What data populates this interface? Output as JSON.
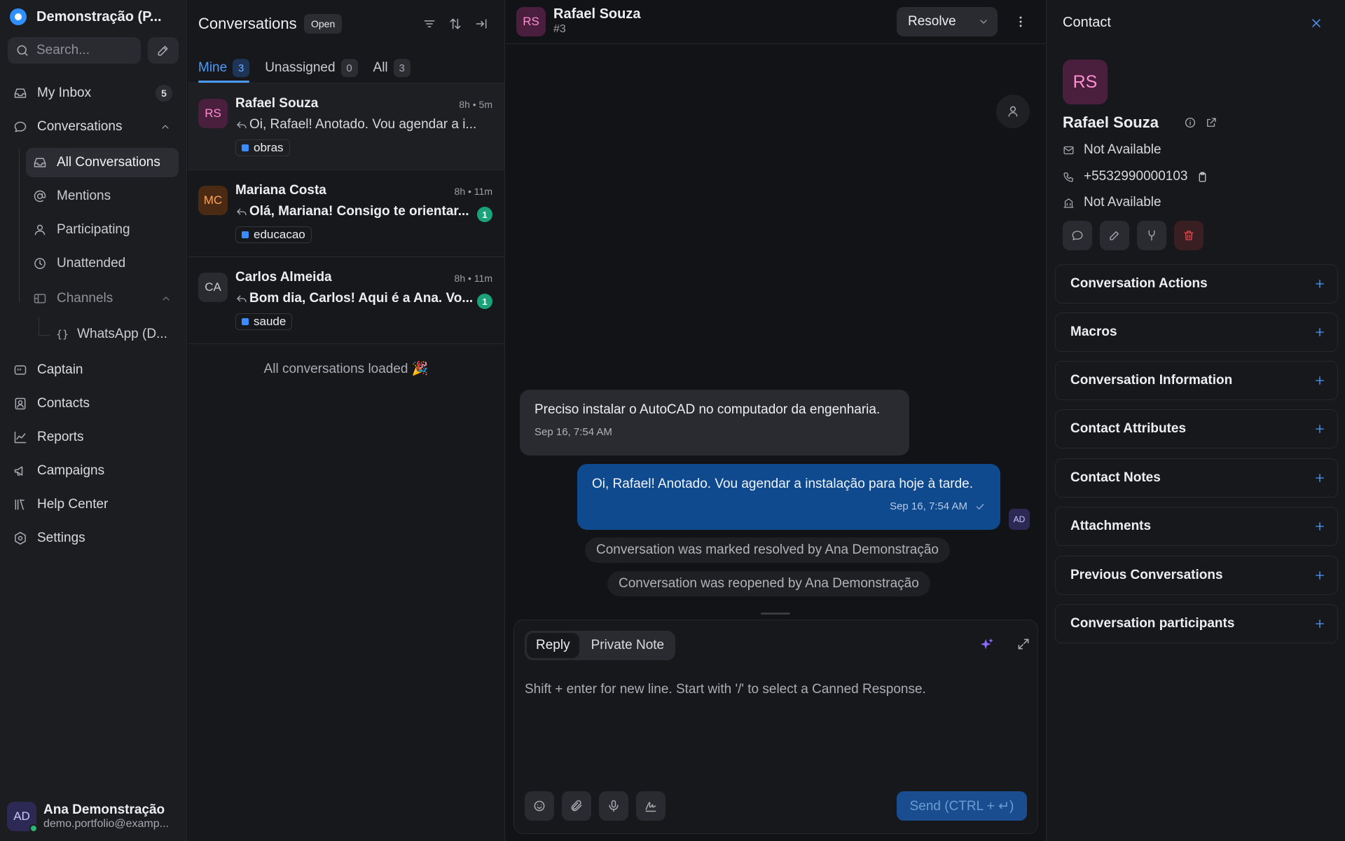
{
  "workspace": {
    "name": "Demonstração (P..."
  },
  "sidebar": {
    "search_placeholder": "Search...",
    "my_inbox": {
      "label": "My Inbox",
      "count": "5"
    },
    "conversations": {
      "label": "Conversations"
    },
    "sub": {
      "all": "All Conversations",
      "mentions": "Mentions",
      "participating": "Participating",
      "unattended": "Unattended",
      "channels": "Channels",
      "whatsapp": "WhatsApp (D..."
    },
    "captain": "Captain",
    "contacts": "Contacts",
    "reports": "Reports",
    "campaigns": "Campaigns",
    "help_center": "Help Center",
    "settings": "Settings",
    "user": {
      "initials": "AD",
      "name": "Ana Demonstração",
      "email": "demo.portfolio@examp..."
    }
  },
  "list": {
    "title": "Conversations",
    "status": "Open",
    "tabs": [
      {
        "label": "Mine",
        "count": "3"
      },
      {
        "label": "Unassigned",
        "count": "0"
      },
      {
        "label": "All",
        "count": "3"
      }
    ],
    "conversations": [
      {
        "initials": "RS",
        "name": "Rafael Souza",
        "time": "8h • 5m",
        "message": "Oi, Rafael! Anotado. Vou agendar a i...",
        "label": "obras",
        "unread": ""
      },
      {
        "initials": "MC",
        "name": "Mariana Costa",
        "time": "8h • 11m",
        "message": "Olá, Mariana! Consigo te orientar...",
        "label": "educacao",
        "unread": "1"
      },
      {
        "initials": "CA",
        "name": "Carlos Almeida",
        "time": "8h • 11m",
        "message": "Bom dia, Carlos! Aqui é a Ana. Vo...",
        "label": "saude",
        "unread": "1"
      }
    ],
    "loaded_text": "All conversations loaded 🎉"
  },
  "chat": {
    "contact_initials": "RS",
    "contact_name": "Rafael Souza",
    "conversation_id": "#3",
    "resolve_label": "Resolve",
    "messages": [
      {
        "text": "Preciso instalar o AutoCAD no computador da engenharia.",
        "time": "Sep 16, 7:54 AM"
      },
      {
        "text": "Oi, Rafael! Anotado. Vou agendar a instalação para hoje à tarde.",
        "time": "Sep 16, 7:54 AM",
        "sender_initials": "AD"
      }
    ],
    "activity": [
      "Conversation was marked resolved by Ana Demonstração",
      "Conversation was reopened by Ana Demonstração"
    ],
    "composer": {
      "reply": "Reply",
      "private_note": "Private Note",
      "placeholder": "Shift + enter for new line. Start with '/' to select a Canned Response.",
      "send": "Send (CTRL + ↵)"
    }
  },
  "contact": {
    "title": "Contact",
    "initials": "RS",
    "name": "Rafael Souza",
    "email": "Not Available",
    "phone": "+5532990000103",
    "company": "Not Available",
    "sections": [
      "Conversation Actions",
      "Macros",
      "Conversation Information",
      "Contact Attributes",
      "Contact Notes",
      "Attachments",
      "Previous Conversations",
      "Conversation participants"
    ]
  },
  "colors": {
    "accent": "#4c9bff",
    "outgoing_bubble": "#0f4a8f",
    "unread_badge": "#1aa37a",
    "label_square": "#3b8cff"
  }
}
